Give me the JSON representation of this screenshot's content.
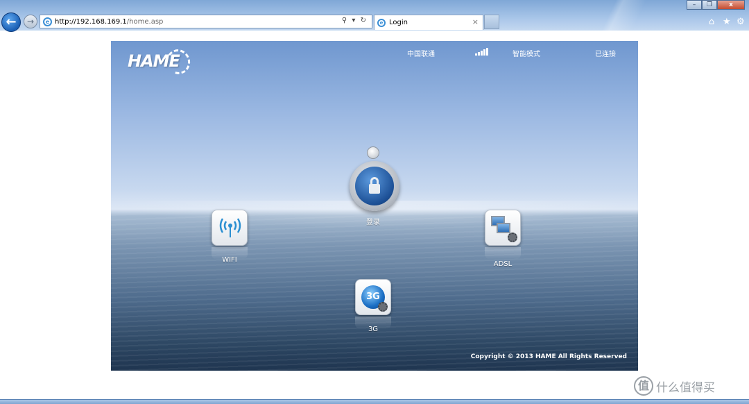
{
  "browser": {
    "url_host": "http://192.168.169.1",
    "url_path": "/home.asp",
    "tab_title": "Login",
    "tab_close": "×",
    "address_tools": "⚲ ▾ ↻",
    "back_glyph": "←",
    "forward_glyph": "→",
    "window_controls": {
      "minimize": "–",
      "restore": "❐",
      "close": "x"
    },
    "right_icons": {
      "home": "⌂",
      "favorites": "★",
      "settings": "⚙"
    }
  },
  "router": {
    "logo": "HAME",
    "status": {
      "carrier": "中国联通",
      "mode": "智能模式",
      "connection": "已连接",
      "signal_bars": 5
    },
    "tiles": {
      "login_label": "登录",
      "wifi_label": "WIFI",
      "adsl_label": "ADSL",
      "threeg_label": "3G",
      "threeg_glyph": "3G"
    },
    "copyright": "Copyright © 2013 HAME All Rights Reserved"
  },
  "watermark": {
    "badge": "值",
    "text": "什么值得买"
  },
  "colors": {
    "accent_blue": "#1a5fb4",
    "wifi_blue": "#2b8fd1"
  }
}
